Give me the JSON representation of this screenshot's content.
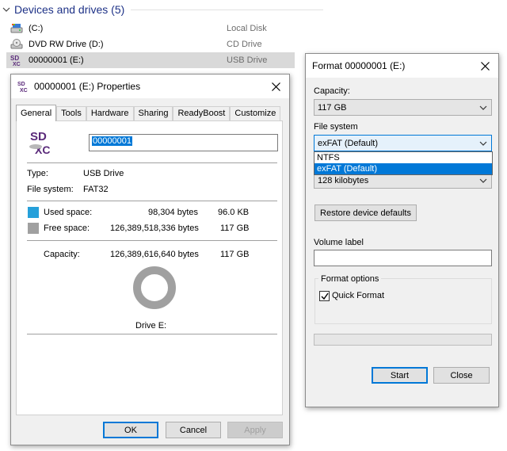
{
  "explorer": {
    "group_header": "Devices and drives (5)",
    "drives": [
      {
        "name": "(C:)",
        "type": "Local Disk",
        "icon": "hard-disk-icon"
      },
      {
        "name": "DVD RW Drive (D:)",
        "type": "CD Drive",
        "icon": "dvd-drive-icon"
      },
      {
        "name": "00000001 (E:)",
        "type": "USB Drive",
        "icon": "sdxc-icon",
        "selected": true
      }
    ]
  },
  "properties": {
    "title": "00000001 (E:) Properties",
    "tabs": [
      "General",
      "Tools",
      "Hardware",
      "Sharing",
      "ReadyBoost",
      "Customize"
    ],
    "active_tab": "General",
    "volume_name": "00000001",
    "type_label": "Type:",
    "type_value": "USB Drive",
    "fs_label": "File system:",
    "fs_value": "FAT32",
    "used_label": "Used space:",
    "used_bytes": "98,304 bytes",
    "used_size": "96.0 KB",
    "free_label": "Free space:",
    "free_bytes": "126,389,518,336 bytes",
    "free_size": "117 GB",
    "capacity_label": "Capacity:",
    "capacity_bytes": "126,389,616,640 bytes",
    "capacity_size": "117 GB",
    "drive_label": "Drive E:",
    "used_fraction": 8e-07,
    "ok_label": "OK",
    "cancel_label": "Cancel",
    "apply_label": "Apply",
    "colors": {
      "used": "#26a0da",
      "free": "#a0a0a0"
    }
  },
  "format": {
    "title": "Format 00000001 (E:)",
    "capacity_label": "Capacity:",
    "capacity_value": "117 GB",
    "fs_label": "File system",
    "fs_value": "exFAT (Default)",
    "fs_options": [
      "NTFS",
      "exFAT (Default)"
    ],
    "alloc_value": "128 kilobytes",
    "restore_label": "Restore device defaults",
    "volume_label": "Volume label",
    "volume_value": "",
    "options_title": "Format options",
    "quick_format_label": "Quick Format",
    "quick_format_checked": true,
    "progress": 0,
    "start_label": "Start",
    "close_label": "Close"
  }
}
